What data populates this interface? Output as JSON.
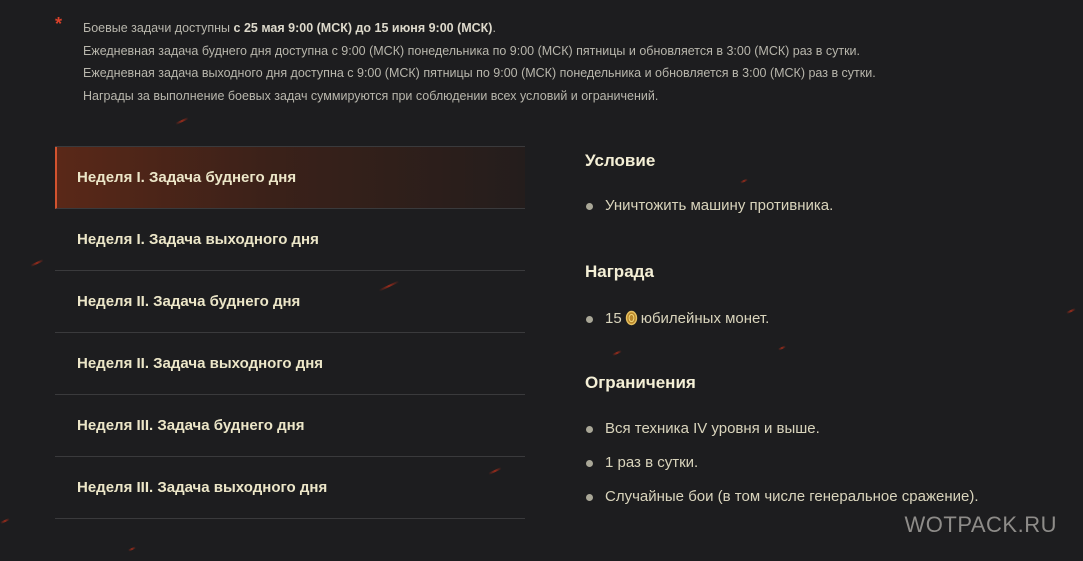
{
  "notes": {
    "asterisk": "*",
    "line1_pre": "Боевые задачи доступны ",
    "line1_bold": "с 25 мая 9:00 (МСК) до 15 июня 9:00 (МСК)",
    "line1_post": ".",
    "line2": "Ежедневная задача буднего дня доступна с 9:00 (МСК) понедельника по 9:00 (МСК) пятницы и обновляется в 3:00 (МСК) раз в сутки.",
    "line3": "Ежедневная задача выходного дня доступна с 9:00 (МСК) пятницы по 9:00 (МСК) понедельника и обновляется в 3:00 (МСК) раз в сутки.",
    "line4": "Награды за выполнение боевых задач суммируются при соблюдении всех условий и ограничений."
  },
  "tabs": [
    {
      "label": "Неделя I. Задача буднего дня",
      "active": true
    },
    {
      "label": "Неделя I. Задача выходного дня",
      "active": false
    },
    {
      "label": "Неделя II. Задача буднего дня",
      "active": false
    },
    {
      "label": "Неделя II. Задача выходного дня",
      "active": false
    },
    {
      "label": "Неделя III. Задача буднего дня",
      "active": false
    },
    {
      "label": "Неделя III. Задача выходного дня",
      "active": false
    }
  ],
  "condition": {
    "title": "Условие",
    "items": [
      "Уничтожить машину противника."
    ]
  },
  "reward": {
    "title": "Награда",
    "amount": "15",
    "text": "юбилейных монет.",
    "icon": "coin-icon"
  },
  "restrictions": {
    "title": "Ограничения",
    "items": [
      "Вся техника IV уровня и выше.",
      "1 раз в сутки.",
      "Случайные бои (в том числе генеральное сражение)."
    ]
  },
  "watermark": "WOTPACK.RU",
  "colors": {
    "background": "#1d1d1f",
    "accent": "#d2532f",
    "asterisk": "#d9412a",
    "text": "#ece6c8"
  }
}
